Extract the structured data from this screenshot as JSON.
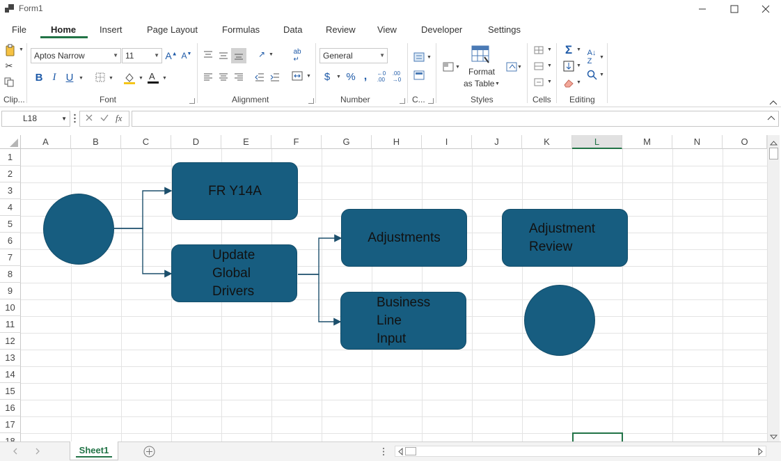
{
  "window": {
    "title": "Form1"
  },
  "ribbon": {
    "tabs": [
      "File",
      "Home",
      "Insert",
      "Page Layout",
      "Formulas",
      "Data",
      "Review",
      "View",
      "Developer",
      "Settings"
    ],
    "active_tab": "Home",
    "font": {
      "name": "Aptos Narrow",
      "size": "11"
    },
    "number_format": "General",
    "format_as_table": {
      "line1": "Format",
      "line2": "as Table"
    },
    "groups": {
      "clipboard": "Clip...",
      "font": "Font",
      "alignment": "Alignment",
      "number": "Number",
      "conditional": "C...",
      "styles": "Styles",
      "cells": "Cells",
      "editing": "Editing"
    }
  },
  "formula_bar": {
    "name_box": "L18",
    "fx_label": "fx",
    "formula": ""
  },
  "grid": {
    "columns": [
      "A",
      "B",
      "C",
      "D",
      "E",
      "F",
      "G",
      "H",
      "I",
      "J",
      "K",
      "L",
      "M",
      "N",
      "O"
    ],
    "rows": [
      "1",
      "2",
      "3",
      "4",
      "5",
      "6",
      "7",
      "8",
      "9",
      "10",
      "11",
      "12",
      "13",
      "14",
      "15",
      "16",
      "17",
      "18"
    ],
    "selected_column": "L",
    "selected_cell": "L18"
  },
  "shapes": {
    "fr_y14a": "FR Y14A",
    "update_drivers": [
      "Update",
      "Global",
      "Drivers"
    ],
    "adjustments": "Adjustments",
    "adjustment_review": [
      "Adjustment",
      "Review"
    ],
    "business_line_input": [
      "Business",
      "Line",
      "Input"
    ]
  },
  "sheets": {
    "tabs": [
      "Sheet1"
    ],
    "active": "Sheet1"
  },
  "colors": {
    "accent": "#217346",
    "shape_fill": "#175d80"
  }
}
